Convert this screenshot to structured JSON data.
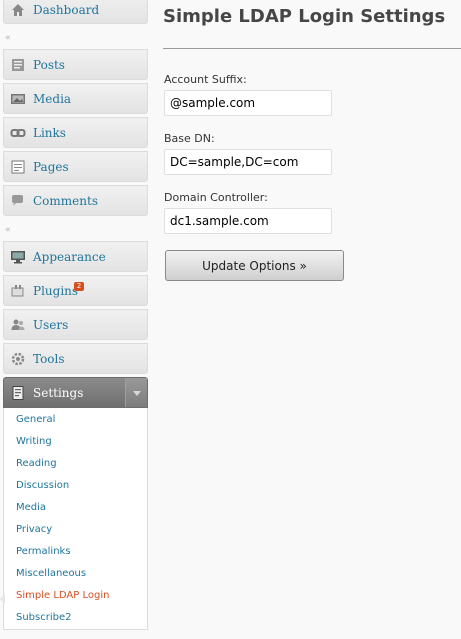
{
  "sidebar": {
    "dashboard_label": "Dashboard",
    "separator_glyph": "«",
    "items": [
      {
        "label": "Posts",
        "icon": "posts-icon"
      },
      {
        "label": "Media",
        "icon": "media-icon"
      },
      {
        "label": "Links",
        "icon": "links-icon"
      },
      {
        "label": "Pages",
        "icon": "pages-icon"
      },
      {
        "label": "Comments",
        "icon": "comments-icon"
      },
      {
        "label": "Appearance",
        "icon": "appearance-icon"
      },
      {
        "label": "Plugins",
        "icon": "plugins-icon",
        "badge": "2"
      },
      {
        "label": "Users",
        "icon": "users-icon"
      },
      {
        "label": "Tools",
        "icon": "tools-icon"
      },
      {
        "label": "Settings",
        "icon": "settings-icon",
        "expanded": true
      }
    ],
    "settings_submenu": [
      "General",
      "Writing",
      "Reading",
      "Discussion",
      "Media",
      "Privacy",
      "Permalinks",
      "Miscellaneous",
      "Simple LDAP Login",
      "Subscribe2"
    ],
    "current_submenu_item": "Simple LDAP Login"
  },
  "main": {
    "title": "Simple LDAP Login Settings",
    "fields": [
      {
        "label": "Account Suffix:",
        "value": "@sample.com"
      },
      {
        "label": "Base DN:",
        "value": "DC=sample,DC=com"
      },
      {
        "label": "Domain Controller:",
        "value": "dc1.sample.com"
      }
    ],
    "submit_label": "Update Options »"
  },
  "colors": {
    "link": "#21759b",
    "current": "#d54e21",
    "badge": "#d54e21",
    "settings_header": "#7d7d7d"
  }
}
